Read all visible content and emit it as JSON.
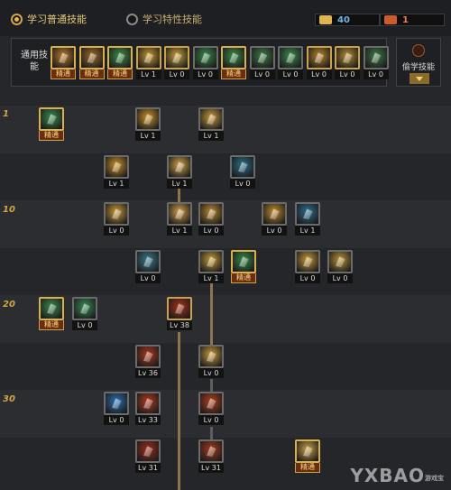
{
  "tabs": [
    {
      "label": "学习普通技能",
      "selected": true
    },
    {
      "label": "学习特性技能",
      "selected": false
    }
  ],
  "points": [
    {
      "value": "40",
      "color": "#6fb6e6",
      "icon_color": "#e0b54e"
    },
    {
      "value": "1",
      "color": "#ef7b4a",
      "icon_color": "#cf5a2a"
    }
  ],
  "common": {
    "label": "通用技能",
    "skills": [
      {
        "cap": "精通",
        "kind": "master",
        "color": "#b97a2c"
      },
      {
        "cap": "精通",
        "kind": "master",
        "color": "#9e6a28"
      },
      {
        "cap": "精通",
        "kind": "master",
        "color": "#3f8f4a"
      },
      {
        "cap": "Lv 1",
        "kind": "gold",
        "color": "#c79a32"
      },
      {
        "cap": "Lv 0",
        "kind": "gold",
        "color": "#c6a33a"
      },
      {
        "cap": "Lv 0",
        "kind": "normal",
        "color": "#3c8a4c"
      },
      {
        "cap": "精通",
        "kind": "master",
        "color": "#3f8a49"
      },
      {
        "cap": "Lv 0",
        "kind": "normal",
        "color": "#3f7b48"
      },
      {
        "cap": "Lv 0",
        "kind": "normal",
        "color": "#3f8a4f"
      },
      {
        "cap": "Lv 0",
        "kind": "gold",
        "color": "#b9862e"
      },
      {
        "cap": "Lv 0",
        "kind": "gold",
        "color": "#b68d35"
      },
      {
        "cap": "Lv 0",
        "kind": "normal",
        "color": "#3e7a48"
      }
    ]
  },
  "steal": {
    "label": "偷学技能"
  },
  "levels": [
    "1",
    "10",
    "20",
    "30"
  ],
  "tree": [
    {
      "cap": "精通",
      "kind": "master",
      "color": "#3a8a4c",
      "icon": "scroll-icon"
    },
    {
      "cap": "Lv 1",
      "kind": "normal",
      "color": "#c9922e",
      "icon": "uppercut-icon"
    },
    {
      "cap": "Lv 1",
      "kind": "normal",
      "color": "#c79a3c",
      "icon": "kick-icon"
    },
    {
      "cap": "Lv 1",
      "kind": "normal",
      "color": "#c8902a",
      "icon": "burst-icon"
    },
    {
      "cap": "Lv 1",
      "kind": "normal",
      "color": "#d1a24a",
      "icon": "bullets-icon"
    },
    {
      "cap": "Lv 0",
      "kind": "normal",
      "color": "#2c6f88",
      "icon": "gun-icon"
    },
    {
      "cap": "Lv 0",
      "kind": "normal",
      "color": "#c79a3a",
      "icon": "slash-icon"
    },
    {
      "cap": "Lv 1",
      "kind": "normal",
      "color": "#d4a04a",
      "icon": "flame-icon"
    },
    {
      "cap": "Lv 0",
      "kind": "normal",
      "color": "#b98a34",
      "icon": "blade-icon"
    },
    {
      "cap": "Lv 0",
      "kind": "normal",
      "color": "#c18c30",
      "icon": "grab-icon"
    },
    {
      "cap": "Lv 1",
      "kind": "normal",
      "color": "#2d6e8e",
      "icon": "spin-icon"
    },
    {
      "cap": "Lv 0",
      "kind": "normal",
      "color": "#3b7a8c",
      "icon": "shot-icon"
    },
    {
      "cap": "Lv 1",
      "kind": "normal",
      "color": "#c29a3a",
      "icon": "grenade-icon"
    },
    {
      "cap": "精通",
      "kind": "master",
      "color": "#3a8a4a",
      "icon": "ammo-icon"
    },
    {
      "cap": "Lv 0",
      "kind": "normal",
      "color": "#c39838",
      "icon": "wave-icon"
    },
    {
      "cap": "Lv 0",
      "kind": "normal",
      "color": "#b69237",
      "icon": "rush-icon"
    },
    {
      "cap": "精通",
      "kind": "master",
      "color": "#3c8a4e",
      "icon": "revolver-icon"
    },
    {
      "cap": "Lv 0",
      "kind": "normal",
      "color": "#3a8a55",
      "icon": "bow-icon"
    },
    {
      "cap": "Lv 38",
      "kind": "gold",
      "color": "#a8331a",
      "icon": "cannon-icon"
    },
    {
      "cap": "Lv 36",
      "kind": "normal",
      "color": "#a93a1d",
      "icon": "barrage-icon"
    },
    {
      "cap": "Lv 0",
      "kind": "normal",
      "color": "#c99a3d",
      "icon": "blast-icon"
    },
    {
      "cap": "Lv 0",
      "kind": "normal",
      "color": "#2c6fb0",
      "icon": "laser-icon"
    },
    {
      "cap": "Lv 33",
      "kind": "normal",
      "color": "#b03a22",
      "icon": "rocket-icon"
    },
    {
      "cap": "Lv 0",
      "kind": "normal",
      "color": "#b2401f",
      "icon": "mine-icon"
    },
    {
      "cap": "Lv 31",
      "kind": "normal",
      "color": "#9c2e1b",
      "icon": "missile-icon"
    },
    {
      "cap": "Lv 31",
      "kind": "normal",
      "color": "#a43a20",
      "icon": "satellite-icon"
    },
    {
      "cap": "精通",
      "kind": "master",
      "color": "#c8a14a",
      "icon": "flare-icon"
    }
  ],
  "watermark": {
    "text": "YXBAO",
    "sub": "游戏宝"
  }
}
